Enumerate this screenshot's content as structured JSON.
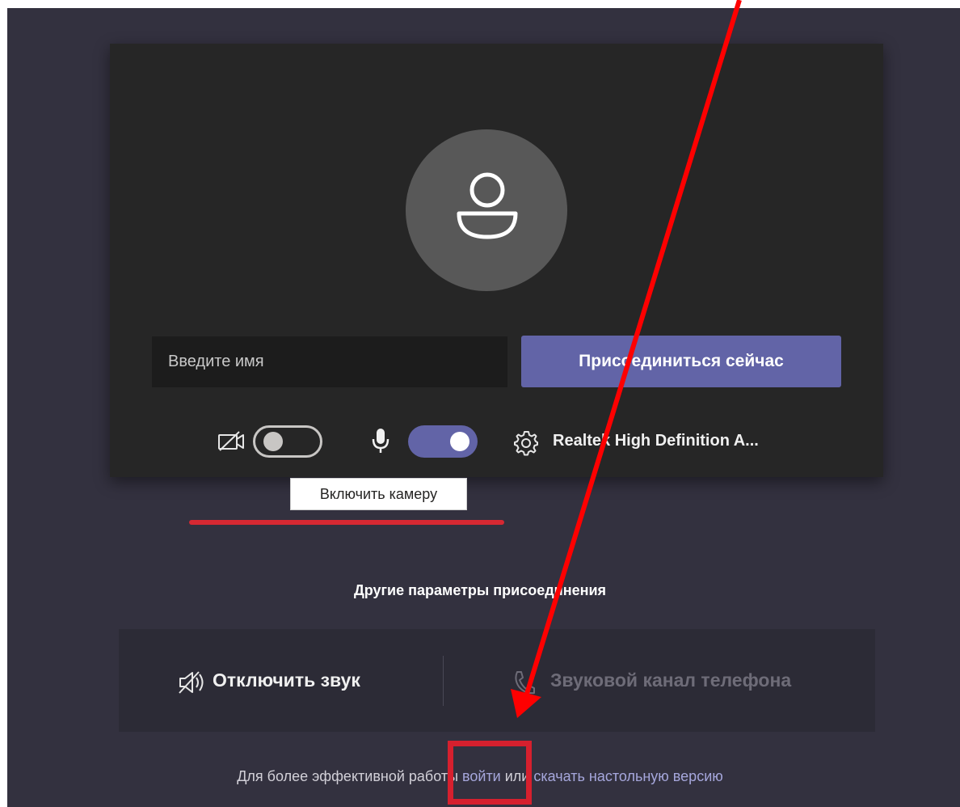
{
  "prejoin": {
    "name_placeholder": "Введите имя",
    "join_button": "Присоединиться сейчас",
    "camera_toggle_on": false,
    "mic_toggle_on": true,
    "audio_device": "Realtek High Definition A...",
    "camera_tooltip": "Включить камеру"
  },
  "other_options": {
    "title": "Другие параметры присоединения",
    "mute_audio": "Отключить звук",
    "phone_audio": "Звуковой канал телефона"
  },
  "footer": {
    "prefix": "Для более эффективной работы ",
    "sign_in": "войти",
    "middle": " или ",
    "download": "скачать настольную версию"
  },
  "colors": {
    "background": "#33313f",
    "card": "#262626",
    "accent": "#6264a7",
    "annotation_red": "#d6202e",
    "link": "#a6a7dc"
  },
  "icons": [
    "user-avatar-icon",
    "camera-off-icon",
    "microphone-icon",
    "gear-icon",
    "speaker-muted-icon",
    "phone-icon"
  ]
}
